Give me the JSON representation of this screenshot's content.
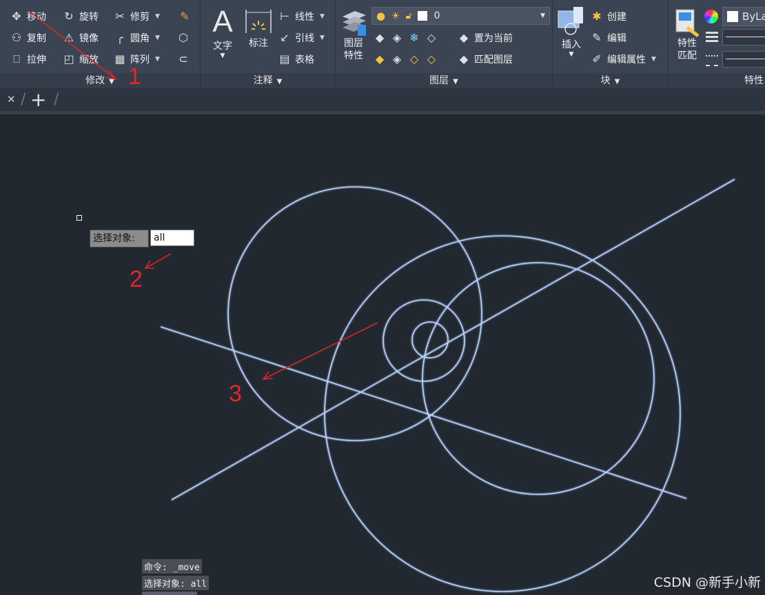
{
  "ribbon": {
    "modify": {
      "title": "修改",
      "tools": [
        "移动",
        "旋转",
        "修剪",
        "复制",
        "镜像",
        "圆角",
        "拉伸",
        "缩放",
        "阵列"
      ]
    },
    "annotate": {
      "title": "注释",
      "text_label": "文字",
      "dim_label": "标注",
      "linear_label": "线性",
      "leader_label": "引线",
      "table_label": "表格"
    },
    "layers": {
      "title": "图层",
      "props_label_1": "图层",
      "props_label_2": "特性",
      "current_layer": "0",
      "set_current_label": "置为当前",
      "match_layer_label": "匹配图层"
    },
    "block": {
      "title": "块",
      "insert_label": "插入",
      "create_label": "创建",
      "edit_label": "编辑",
      "edit_attr_label": "编辑属性"
    },
    "properties": {
      "match_label_1": "特性",
      "match_label_2": "匹配",
      "bylayer_value": "ByLa",
      "title_partial": "特性"
    }
  },
  "prompt": {
    "label": "选择对象:",
    "value": "all"
  },
  "command_history": [
    "命令: _move",
    "选择对象: all"
  ],
  "annotations": [
    "1",
    "2",
    "3"
  ],
  "watermark": "CSDN @新手小新",
  "colors": {
    "canvas": "#212830",
    "geometry": "#a8c8ff",
    "annotation_red": "#e0282b",
    "ribbon": "#3b4453"
  }
}
